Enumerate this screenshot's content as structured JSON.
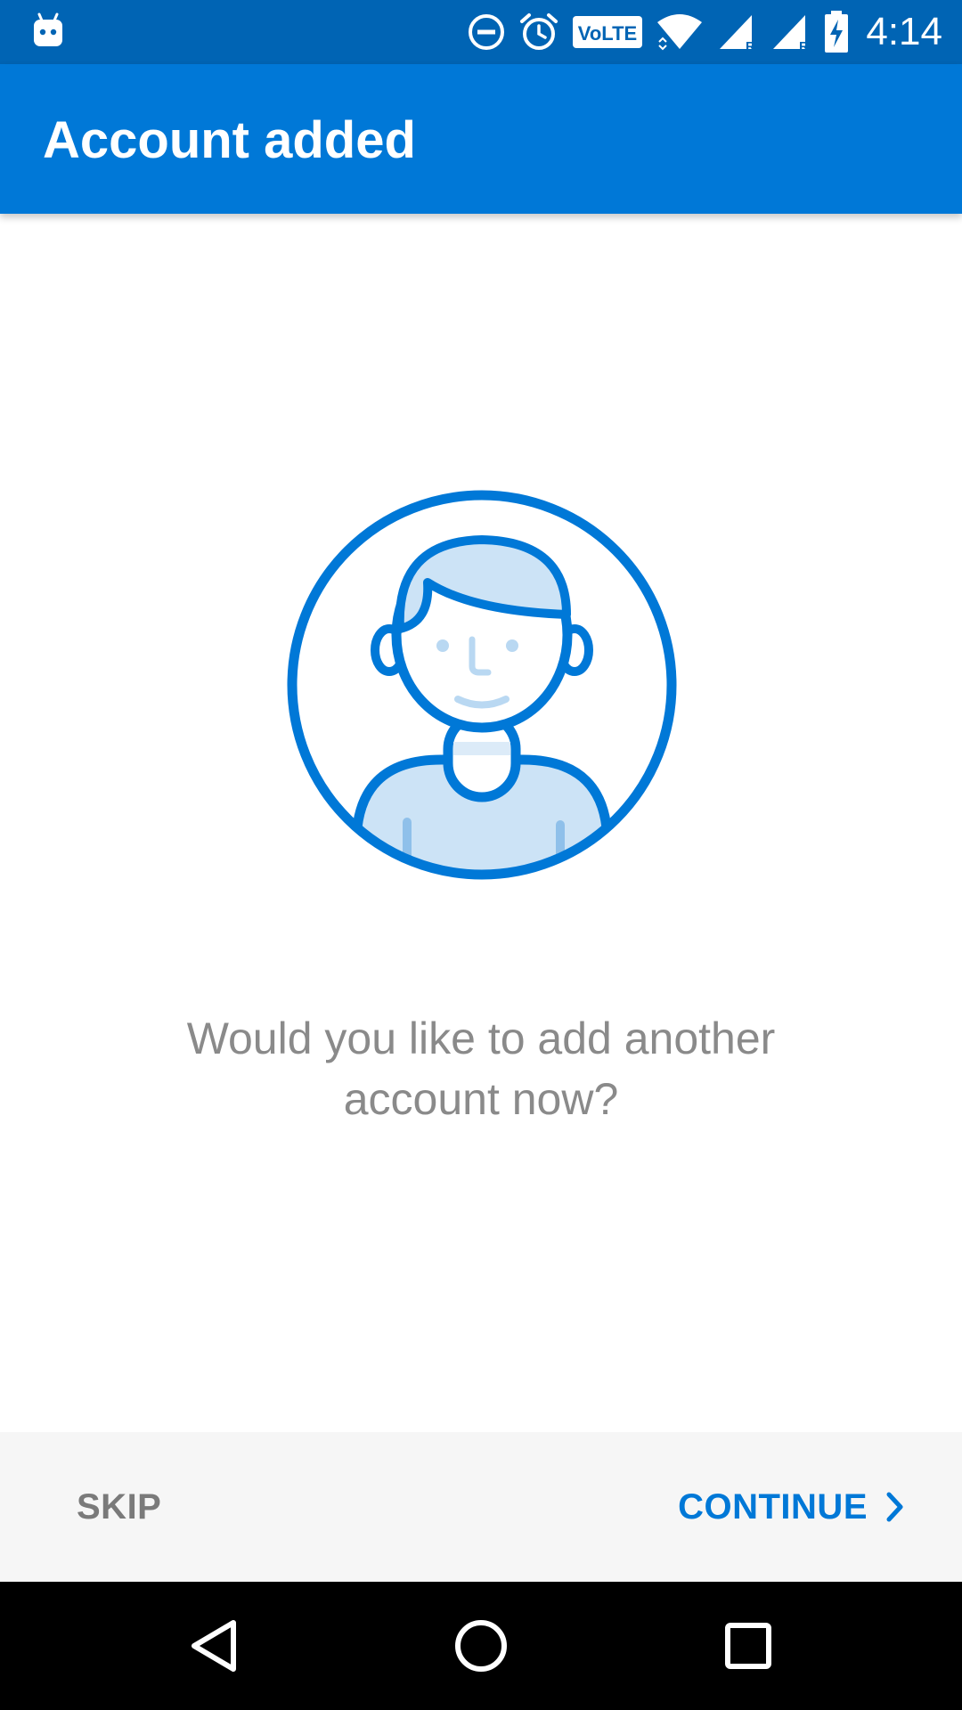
{
  "status_bar": {
    "time": "4:14",
    "volte_label": "VoLTE",
    "roaming_label_1": "R",
    "roaming_label_2": "R",
    "icons": [
      "android-debug-icon",
      "do-not-disturb-icon",
      "alarm-icon",
      "volte-icon",
      "wifi-icon",
      "signal-roaming-icon",
      "signal-roaming-icon",
      "battery-charging-icon"
    ]
  },
  "app_bar": {
    "title": "Account added"
  },
  "illustration": {
    "icon": "user-avatar-icon",
    "accent_color": "#0078d7",
    "fill_color": "#cce3f6"
  },
  "prompt": {
    "line1": "Would you like to add another",
    "line2": "account now?"
  },
  "footer": {
    "skip_label": "SKIP",
    "continue_label": "CONTINUE",
    "continue_icon": "chevron-right-icon"
  },
  "nav_bar": {
    "icons": [
      "back-icon",
      "home-icon",
      "recents-icon"
    ]
  },
  "colors": {
    "status_bar": "#0064b4",
    "app_bar": "#0078d7",
    "footer_bg": "#f6f6f6",
    "prompt_text": "#8a8a8a",
    "skip_text": "#7a7a7a"
  }
}
